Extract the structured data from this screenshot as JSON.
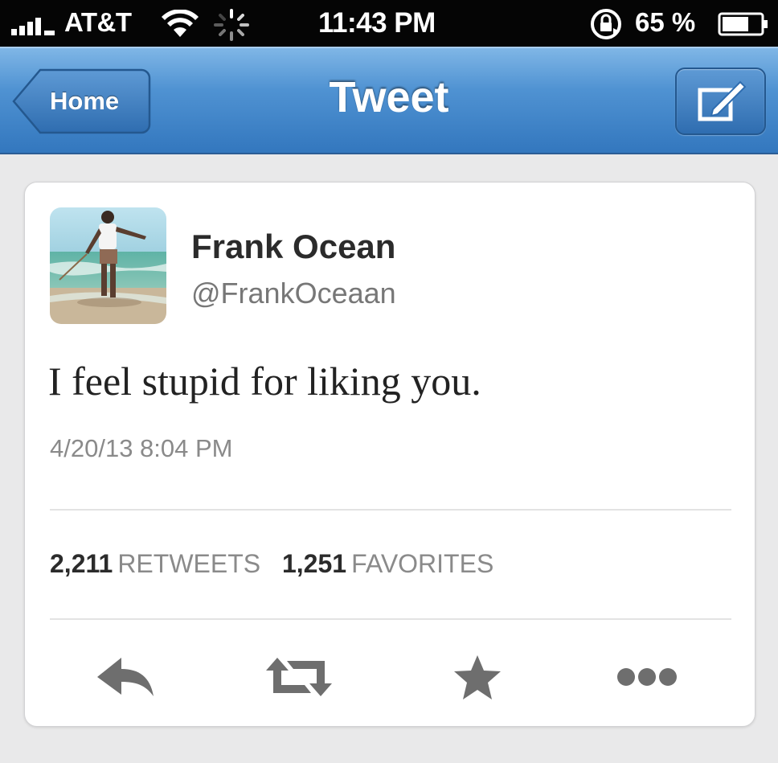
{
  "status_bar": {
    "carrier": "AT&T",
    "time": "11:43 PM",
    "battery_percent": "65 %",
    "icons": [
      "signal-bars-icon",
      "wifi-icon",
      "activity-spinner-icon",
      "orientation-lock-icon",
      "battery-icon"
    ]
  },
  "nav": {
    "back_label": "Home",
    "title": "Tweet",
    "compose_icon": "compose-icon"
  },
  "tweet": {
    "display_name": "Frank Ocean",
    "handle": "@FrankOceaan",
    "text": "I feel stupid for liking you.",
    "timestamp": "4/20/13 8:04 PM",
    "retweets_count": "2,211",
    "retweets_label": "RETWEETS",
    "favorites_count": "1,251",
    "favorites_label": "FAVORITES"
  },
  "actions": [
    {
      "name": "reply",
      "icon": "reply-icon"
    },
    {
      "name": "retweet",
      "icon": "retweet-icon"
    },
    {
      "name": "favorite",
      "icon": "star-icon"
    },
    {
      "name": "more",
      "icon": "more-dots-icon"
    }
  ],
  "colors": {
    "nav_blue": "#3f86c9",
    "status_bar": "#050505",
    "background": "#e9e9ea",
    "action_icon": "#6e6e6e"
  }
}
